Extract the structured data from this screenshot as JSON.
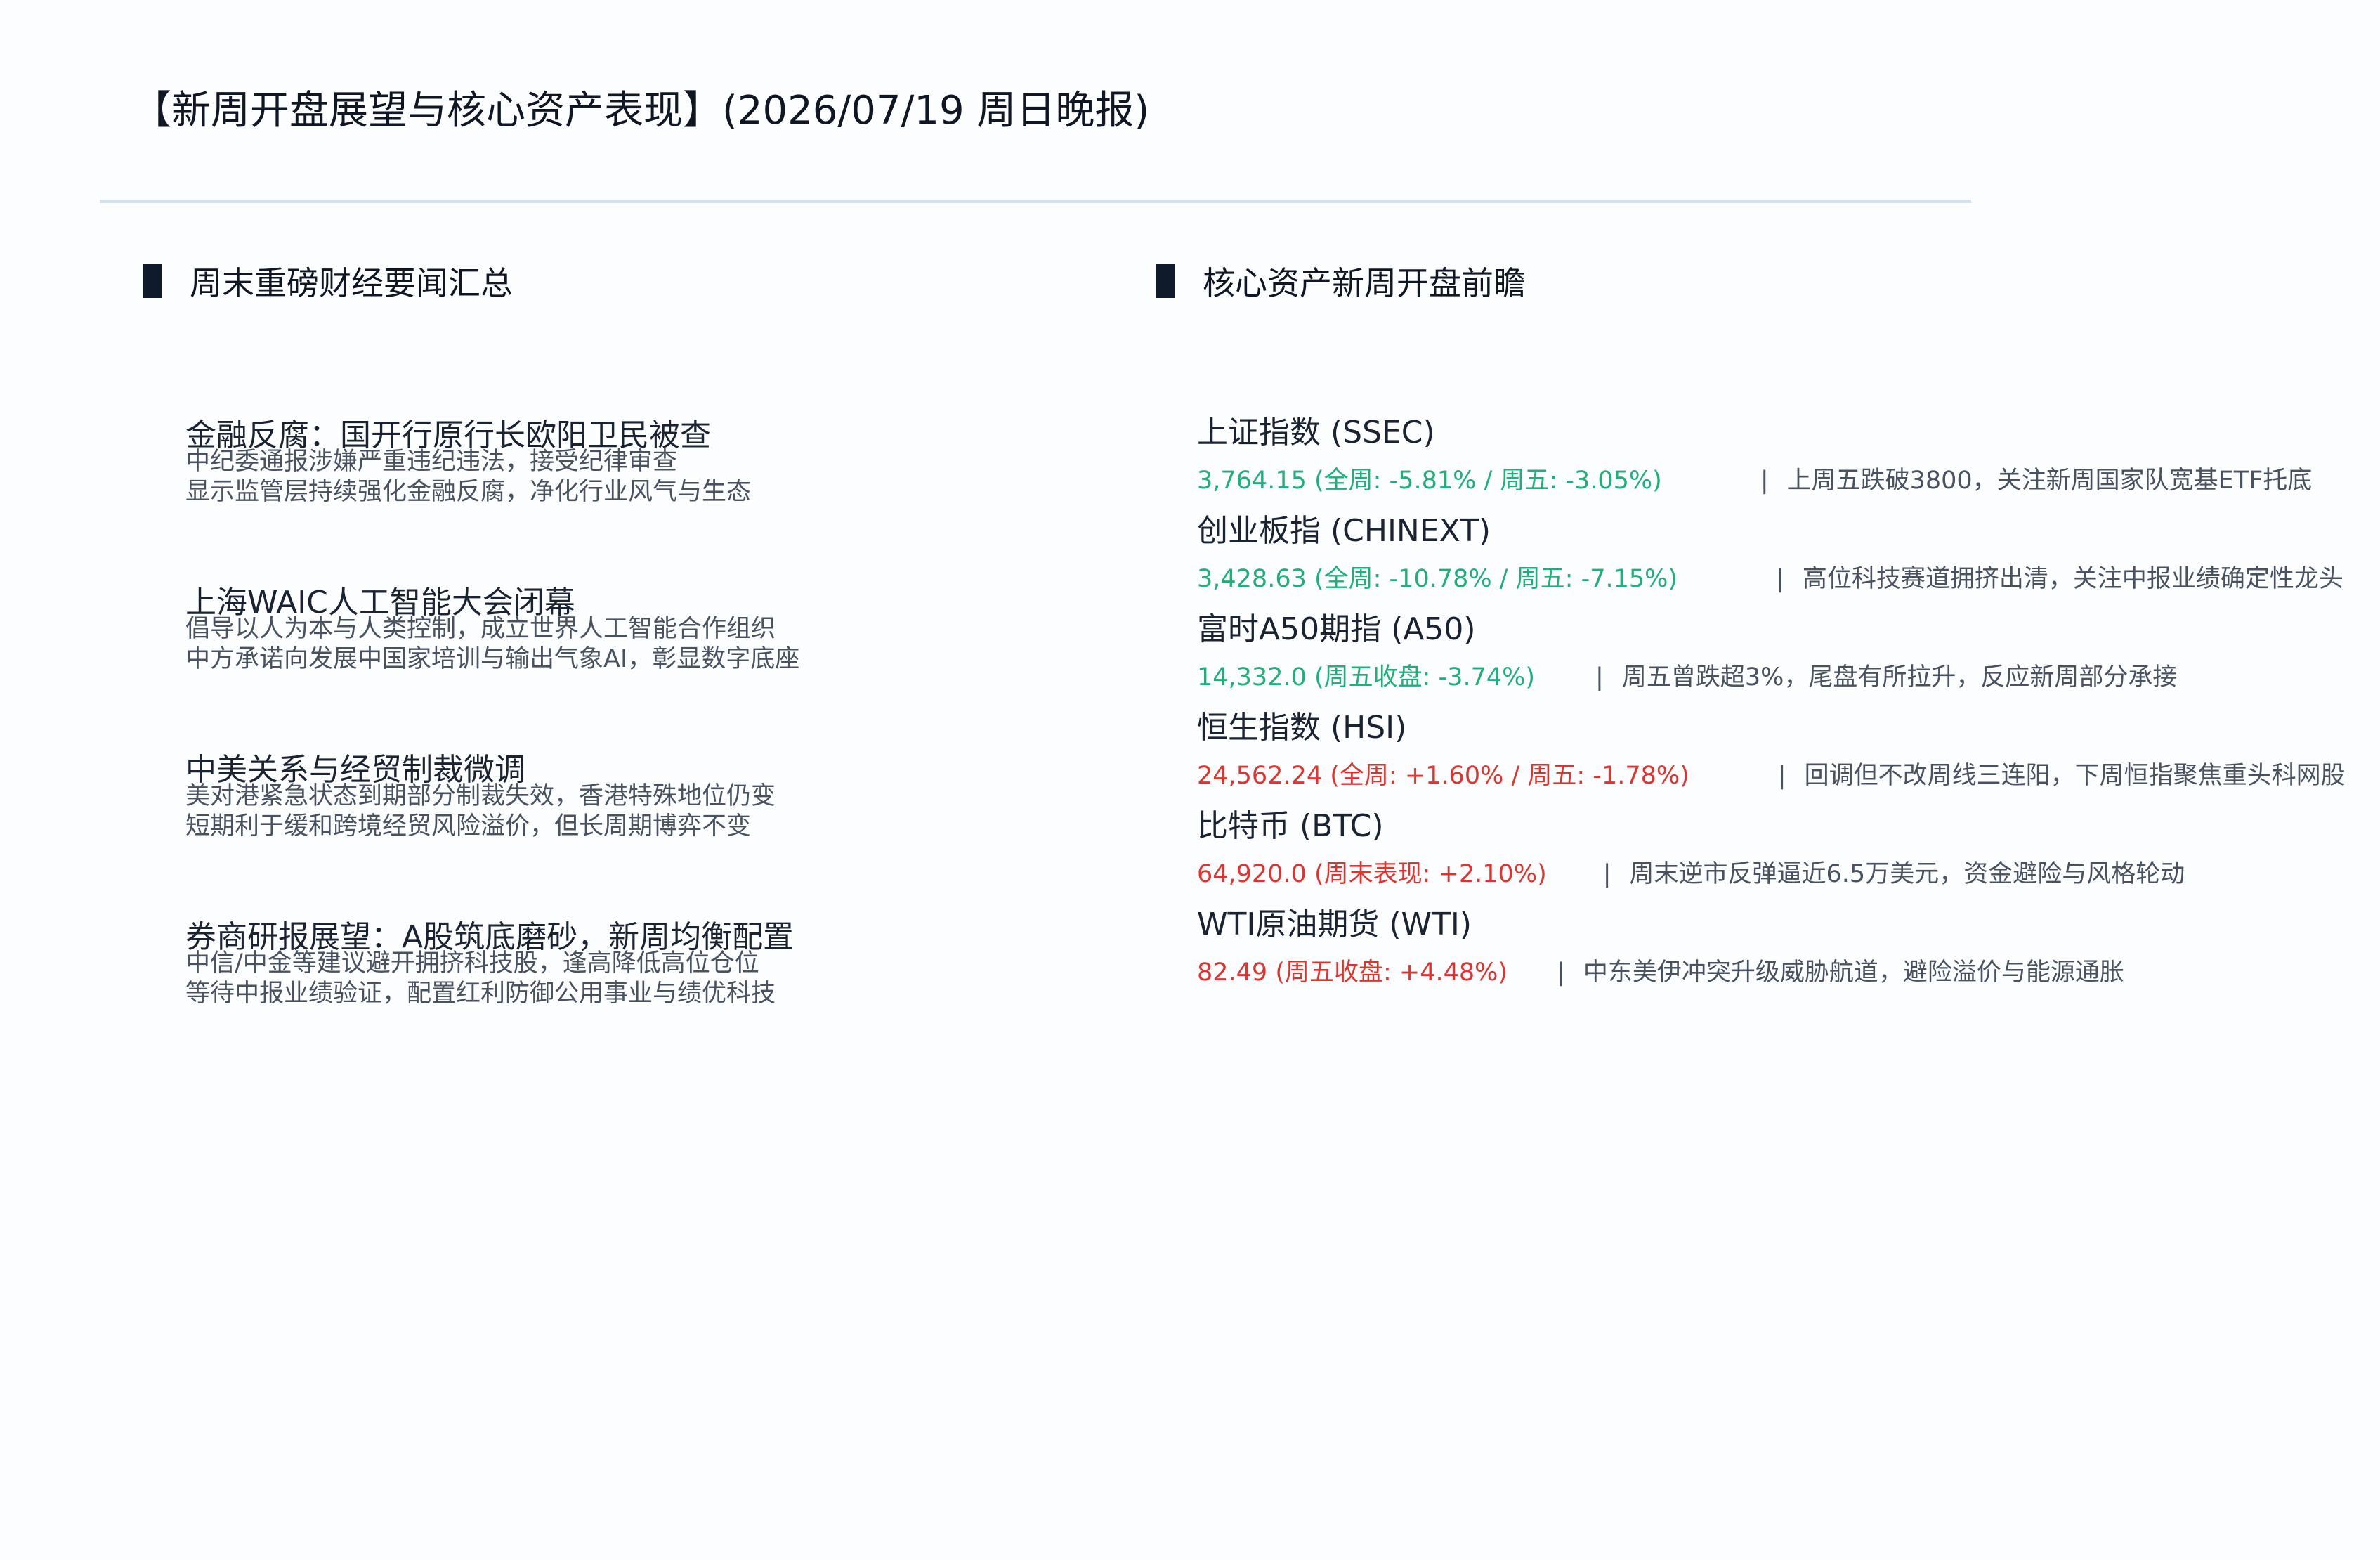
{
  "header": {
    "title": "【新周开盘展望与核心资产表现】(2026/07/19 周日晚报)"
  },
  "colors": {
    "down": "#1fb07a",
    "up": "#e0332f",
    "accent_bar": "#0f1a2b",
    "rule": "#d3e1ec"
  },
  "news": {
    "heading": "周末重磅财经要闻汇总",
    "items": [
      {
        "title": "金融反腐：国开行原行长欧阳卫民被查",
        "lines": [
          "中纪委通报涉嫌严重违纪违法，接受纪律审查",
          "显示监管层持续强化金融反腐，净化行业风气与生态"
        ]
      },
      {
        "title": "上海WAIC人工智能大会闭幕",
        "lines": [
          "倡导以人为本与人类控制，成立世界人工智能合作组织",
          "中方承诺向发展中国家培训与输出气象AI，彰显数字底座"
        ]
      },
      {
        "title": "中美关系与经贸制裁微调",
        "lines": [
          "美对港紧急状态到期部分制裁失效，香港特殊地位仍变",
          "短期利于缓和跨境经贸风险溢价，但长周期博弈不变"
        ]
      },
      {
        "title": "券商研报展望：A股筑底磨砂，新周均衡配置",
        "lines": [
          "中信/中金等建议避开拥挤科技股，逢高降低高位仓位",
          "等待中报业绩验证，配置红利防御公用事业与绩优科技"
        ]
      }
    ]
  },
  "assets": {
    "heading": "核心资产新周开盘前瞻",
    "separator": "|",
    "items": [
      {
        "name": "上证指数 (SSEC)",
        "value": "3,764.15 (全周: -5.81% / 周五: -3.05%)",
        "trend": "down",
        "note": "上周五跌破3800，关注新周国家队宽基ETF托底"
      },
      {
        "name": "创业板指 (CHINEXT)",
        "value": "3,428.63 (全周: -10.78% / 周五: -7.15%)",
        "trend": "down",
        "note": "高位科技赛道拥挤出清，关注中报业绩确定性龙头"
      },
      {
        "name": "富时A50期指 (A50)",
        "value": "14,332.0 (周五收盘: -3.74%)",
        "trend": "down",
        "note": "周五曾跌超3%，尾盘有所拉升，反应新周部分承接"
      },
      {
        "name": "恒生指数 (HSI)",
        "value": "24,562.24 (全周: +1.60% / 周五: -1.78%)",
        "trend": "up",
        "note": "回调但不改周线三连阳，下周恒指聚焦重头科网股"
      },
      {
        "name": "比特币 (BTC)",
        "value": "64,920.0 (周末表现: +2.10%)",
        "trend": "up",
        "note": "周末逆市反弹逼近6.5万美元，资金避险与风格轮动"
      },
      {
        "name": "WTI原油期货 (WTI)",
        "value": "82.49 (周五收盘: +4.48%)",
        "trend": "up",
        "note": "中东美伊冲突升级威胁航道，避险溢价与能源通胀"
      }
    ]
  }
}
